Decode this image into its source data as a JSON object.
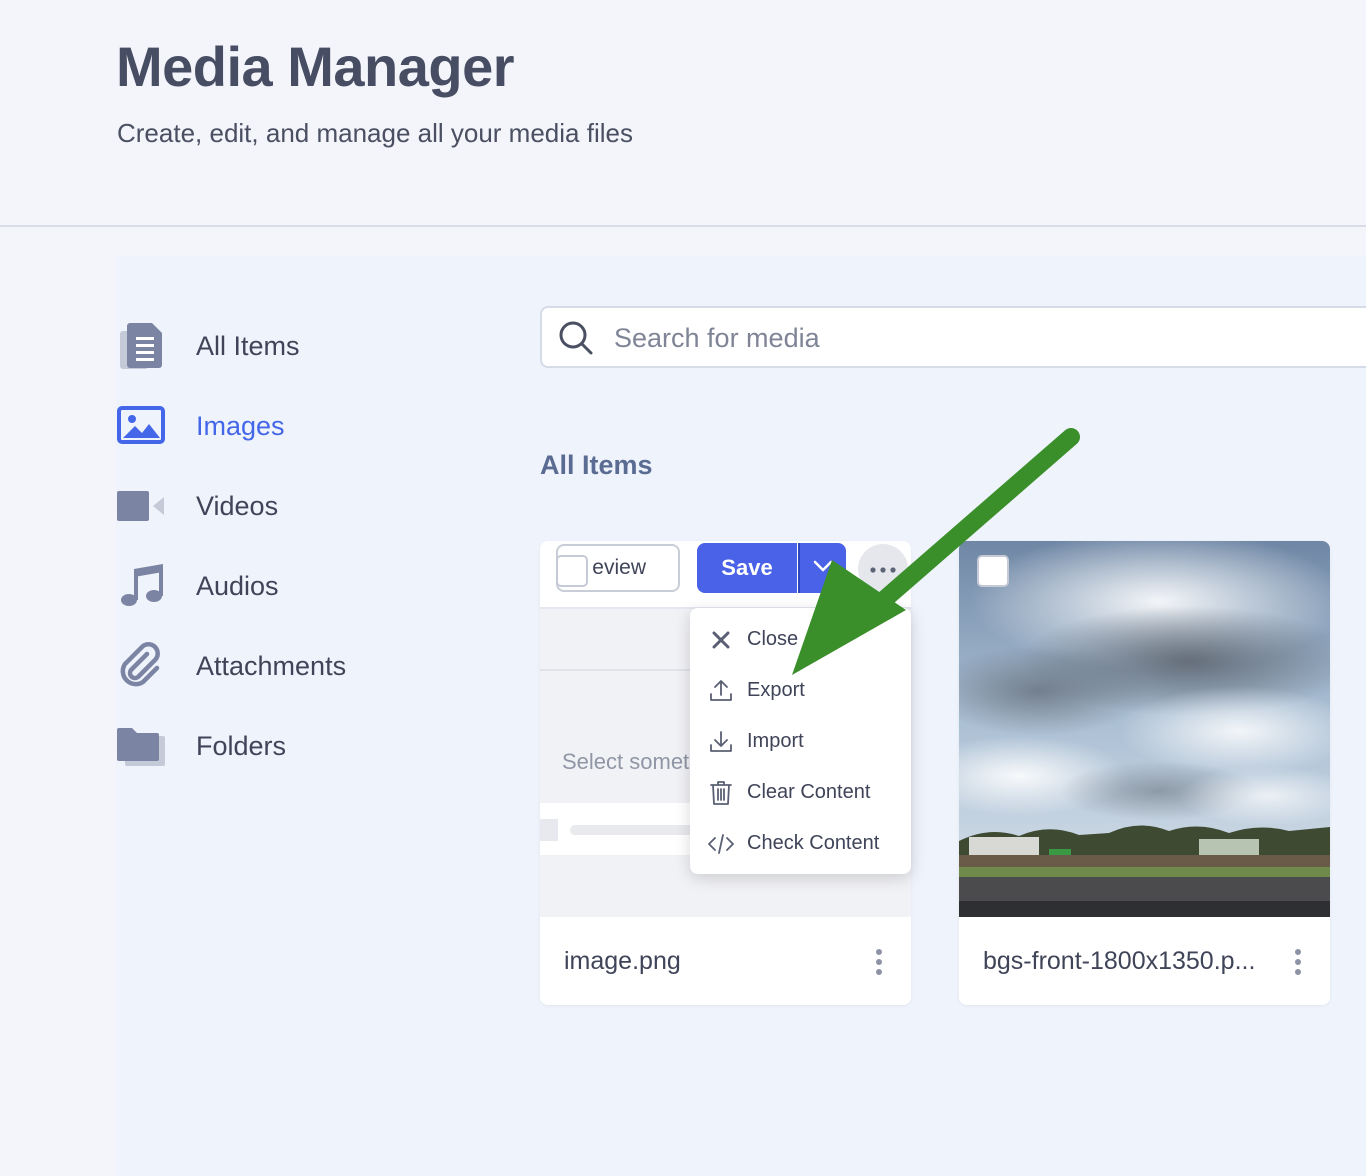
{
  "header": {
    "title": "Media Manager",
    "subtitle": "Create, edit, and manage all your media files"
  },
  "sidebar": {
    "items": [
      {
        "label": "All Items",
        "icon": "documents-icon"
      },
      {
        "label": "Images",
        "icon": "image-icon",
        "active": true
      },
      {
        "label": "Videos",
        "icon": "video-icon"
      },
      {
        "label": "Audios",
        "icon": "music-note-icon"
      },
      {
        "label": "Attachments",
        "icon": "paperclip-icon"
      },
      {
        "label": "Folders",
        "icon": "folder-icon"
      }
    ]
  },
  "search": {
    "placeholder": "Search for media"
  },
  "main": {
    "section_title": "All Items",
    "cards": [
      {
        "name": "image.png",
        "preview": {
          "preview_button_label": "eview",
          "save_label": "Save",
          "select_text": "Select somet",
          "menu": [
            {
              "label": "Close",
              "icon": "close-icon"
            },
            {
              "label": "Export",
              "icon": "upload-icon"
            },
            {
              "label": "Import",
              "icon": "download-icon"
            },
            {
              "label": "Clear Content",
              "icon": "trash-icon"
            },
            {
              "label": "Check Content",
              "icon": "code-icon"
            }
          ]
        }
      },
      {
        "name": "bgs-front-1800x1350.p..."
      }
    ]
  },
  "colors": {
    "accent": "#4466e8",
    "save_button": "#4a62e8",
    "annotation_arrow": "#3a8f2a",
    "background": "#eff3fb"
  }
}
